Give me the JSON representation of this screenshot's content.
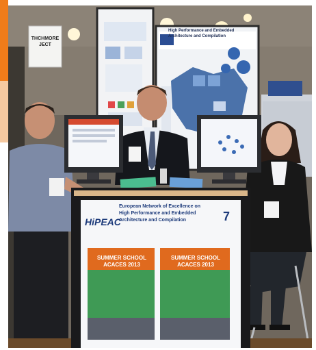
{
  "signs": {
    "left_sign": "THCHMORE JECT",
    "poster_title_line1": "High Performance and Embedded",
    "poster_title_line2": "Architecture and Compilation"
  },
  "booth": {
    "logo": "HiPEAC",
    "banner_line1": "European Network of Excellence on",
    "banner_line2": "High Performance and Embedded",
    "banner_line3": "Architecture and Compilation",
    "banner_number": "7"
  },
  "posters": [
    {
      "title_line1": "SUMMER SCHOOL",
      "title_line2": "ACACES 2013"
    },
    {
      "title_line1": "SUMMER SCHOOL",
      "title_line2": "ACACES 2013"
    }
  ],
  "colors": {
    "accent_orange": "#f07c1a",
    "hipeac_blue": "#1c3a7a",
    "poster_orange": "#e06a1e",
    "poster_green": "#3f9a55"
  }
}
